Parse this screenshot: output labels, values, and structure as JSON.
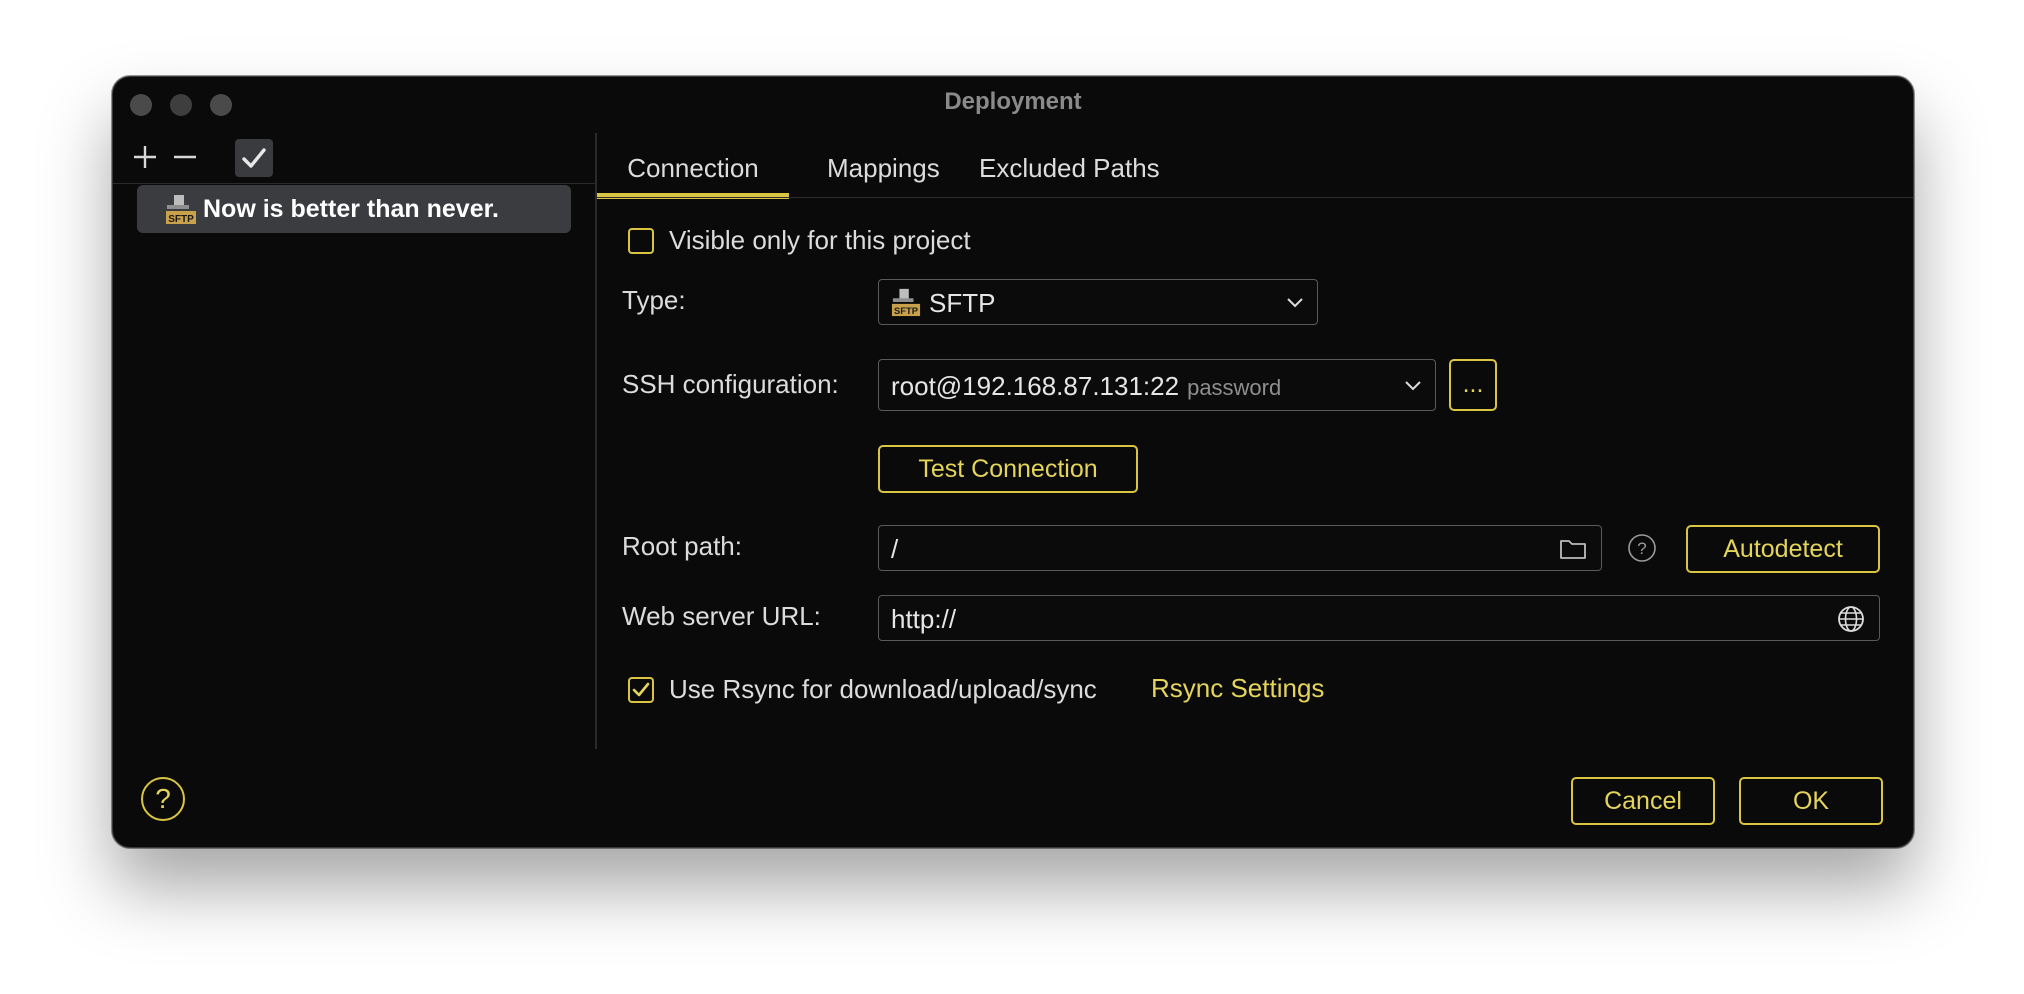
{
  "window": {
    "title": "Deployment"
  },
  "left_panel": {
    "server_name": "Now is better than never."
  },
  "tabs": [
    {
      "label": "Connection",
      "active": true
    },
    {
      "label": "Mappings",
      "active": false
    },
    {
      "label": "Excluded Paths",
      "active": false
    }
  ],
  "form": {
    "visible_only_label": "Visible only for this project",
    "visible_only_checked": false,
    "type_label": "Type:",
    "type_value": "SFTP",
    "ssh_label": "SSH configuration:",
    "ssh_value": "root@192.168.87.131:22",
    "ssh_hint": "password",
    "ssh_more_label": "...",
    "test_connection_label": "Test Connection",
    "root_path_label": "Root path:",
    "root_path_value": "/",
    "autodetect_label": "Autodetect",
    "web_url_label": "Web server URL:",
    "web_url_value": "http://",
    "rsync_label": "Use Rsync for download/upload/sync",
    "rsync_checked": true,
    "rsync_settings_label": "Rsync Settings"
  },
  "footer": {
    "help_label": "?",
    "cancel_label": "Cancel",
    "ok_label": "OK"
  },
  "colors": {
    "accent": "#d9c541",
    "background": "#0a0a0a",
    "selection": "#3b3c40"
  }
}
